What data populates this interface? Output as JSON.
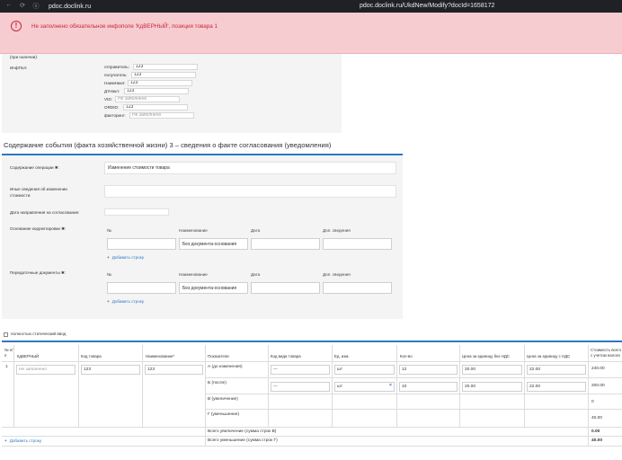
{
  "browser": {
    "host": "pdoc.doclink.ru",
    "url": "pdoc.doclink.ru/UkdNew/Modify?docId=1658172",
    "nav_back": "←",
    "nav_forward": "→",
    "nav_reload": "⟳",
    "nav_site": "ⓢ"
  },
  "alert": {
    "icon_glyph": "!",
    "message": "Не заполнено обязательное инфополе 'КдВЕРНЫЙ', позиция товара 1"
  },
  "info_block": {
    "partial_label": "(при наличии):",
    "infpol_label": "ИнфПол:",
    "rows": [
      {
        "label": "отправитель:",
        "value": "123"
      },
      {
        "label": "получатель:",
        "value": "123"
      },
      {
        "label": "НаимНакл:",
        "value": "123"
      },
      {
        "label": "ДтНакл:",
        "value": "123"
      },
      {
        "label": "VID:",
        "value": "",
        "placeholder": "Не заполнено"
      },
      {
        "label": "ORDID:",
        "value": "123"
      },
      {
        "label": "факторинг:",
        "value": "",
        "placeholder": "Не заполнено"
      }
    ]
  },
  "section": {
    "title": "Содержание события (факта хозяйственной жизни) 3 – сведения о факте согласования (уведомления)",
    "op_content_label": "Содержание операции ✱:",
    "op_content_value": "Изменение стоимости товара",
    "other_info_label_1": "Иные сведения об изменении",
    "other_info_label_2": "стоимости:",
    "send_date_label": "Дата направления на согласование:",
    "basis_label": "Основание корректировки ✱:",
    "transfer_docs_label": "Передаточные документы ✱:",
    "grid_headers": [
      "№",
      "Наименование",
      "Дата",
      "Доп. сведения"
    ],
    "no_doc_basis": "Без документа-основания",
    "add_row": "Добавить строку",
    "add_plus": "+"
  },
  "checkbox": {
    "label": "полностью статический ввод"
  },
  "table": {
    "headers": {
      "num": "№ п/п",
      "kdverny": "КдВЕРНЫЙ",
      "code": "Код товара",
      "name": "Наименование*",
      "indicators": "Показатели",
      "kind_code": "Код вида товара",
      "unit": "Ед. изм.",
      "qty": "Кол-во",
      "price_no_vat": "Цена за единицу без НДС",
      "price_vat": "Цена за единицу с НДС",
      "cost": "Стоимость всего с учетом налога"
    },
    "row": {
      "num": "1",
      "kdverny_placeholder": "Не заполнено",
      "code": "123",
      "name": "123"
    },
    "indicators": [
      {
        "label": "А (до изменения)",
        "kind": "---",
        "unit": "шт",
        "qty": "12",
        "price_no_vat": "20.00",
        "price_vat": "22.00",
        "cost": "240.00"
      },
      {
        "label": "Б (после)",
        "kind": "---",
        "unit": "шт",
        "qty": "10",
        "price_no_vat": "20.00",
        "price_vat": "22.00",
        "cost": "200.00"
      },
      {
        "label": "В (увеличение)",
        "cost": "0"
      },
      {
        "label": "Г (уменьшение)",
        "cost": "40.00"
      }
    ],
    "unit_clear": "×",
    "total_increase_label": "Всего увеличение (сумма строк В)",
    "total_increase_value": "0.00",
    "total_decrease_label": "Всего уменьшение (сумма строк Г)",
    "total_decrease_value": "40.00",
    "add_row": "Добавить строку",
    "add_plus": "+"
  },
  "colors": {
    "accent": "#2b79c2",
    "alert_bg": "#f6ccd0",
    "alert_text": "#c5283d"
  }
}
